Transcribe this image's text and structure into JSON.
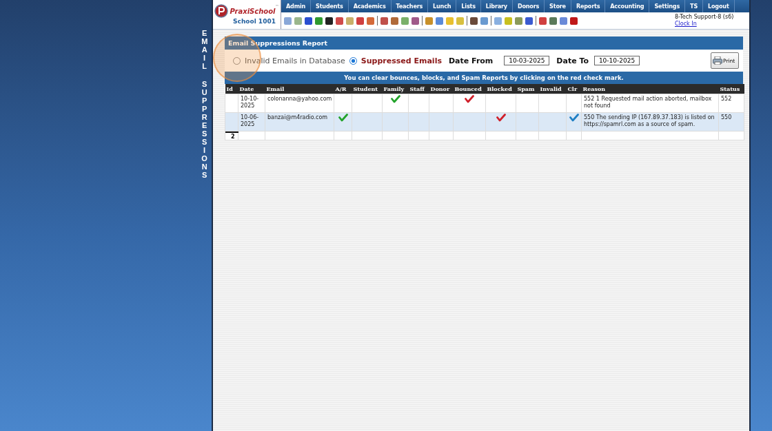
{
  "side_title": [
    "EMAIL",
    "SUPPRESSIONS"
  ],
  "logo": {
    "brand_first": "Praxi",
    "brand_second": "School",
    "trademark": "™",
    "school": "School 1001"
  },
  "menu": [
    "Admin",
    "Students",
    "Academics",
    "Teachers",
    "Lunch",
    "Lists",
    "Library",
    "Donors",
    "Store",
    "Reports",
    "Accounting",
    "Settings",
    "TS",
    "Logout"
  ],
  "user": {
    "name": "8-Tech Support-8 (s6)",
    "clock_link": "Clock In"
  },
  "report": {
    "title": "Email Suppressions Report",
    "modes": [
      {
        "label": "Invalid Emails in Database",
        "selected": false
      },
      {
        "label": "Suppressed Emails",
        "selected": true
      }
    ],
    "date_from": {
      "label": "Date From",
      "value": "10-03-2025"
    },
    "date_to": {
      "label": "Date To",
      "value": "10-10-2025"
    },
    "print_button": "Print",
    "notice": "You can clear bounces, blocks, and Spam Reports by clicking on the red check mark.",
    "columns": [
      "Id",
      "Date",
      "Email",
      "A/R",
      "Student",
      "Family",
      "Staff",
      "Donor",
      "Bounced",
      "Blocked",
      "Spam",
      "Invalid",
      "Clr",
      "Reason",
      "Status"
    ],
    "rows": [
      {
        "selected": false,
        "date": "10-10-2025",
        "email": "colonanna@yahoo.com",
        "checks": [
          {
            "checked": false
          },
          {
            "checked": false
          },
          {
            "checked": true,
            "color": "#22a32a"
          },
          {
            "checked": false
          },
          {
            "checked": false
          },
          {
            "checked": true,
            "color": "#d0202a"
          },
          {
            "checked": false
          },
          {
            "checked": false
          },
          {
            "checked": false
          },
          {
            "checked": false
          }
        ],
        "reason": "552 1 Requested mail action aborted, mailbox not found",
        "status": "552"
      },
      {
        "selected": true,
        "date": "10-06-2025",
        "email": "banzai@m4radio.com",
        "checks": [
          {
            "checked": true,
            "color": "#22a32a"
          },
          {
            "checked": false
          },
          {
            "checked": false
          },
          {
            "checked": false
          },
          {
            "checked": false
          },
          {
            "checked": false
          },
          {
            "checked": true,
            "color": "#d0202a"
          },
          {
            "checked": false
          },
          {
            "checked": false
          },
          {
            "checked": true,
            "color": "#1f7fc4"
          }
        ],
        "reason": "550 The sending IP (167.89.37.183) is listed on https://spamrl.com as a source of spam.",
        "status": "550"
      }
    ],
    "total": "2"
  }
}
